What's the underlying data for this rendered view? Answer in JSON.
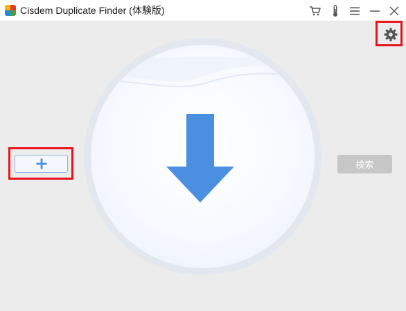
{
  "window": {
    "title": "Cisdem Duplicate Finder (体験版)"
  },
  "titlebar": {
    "icons": [
      "cart-icon",
      "thermometer-icon",
      "menu-icon",
      "minimize-icon",
      "close-icon"
    ]
  },
  "main": {
    "settings_icon": "gear-icon",
    "add_icon": "plus-icon",
    "drop_icon": "arrow-down-icon",
    "search_label": "検索",
    "search_enabled": false
  },
  "colors": {
    "accent": "#4a8fe0",
    "highlight": "#e8141c",
    "disabled": "#c7c7c7"
  }
}
